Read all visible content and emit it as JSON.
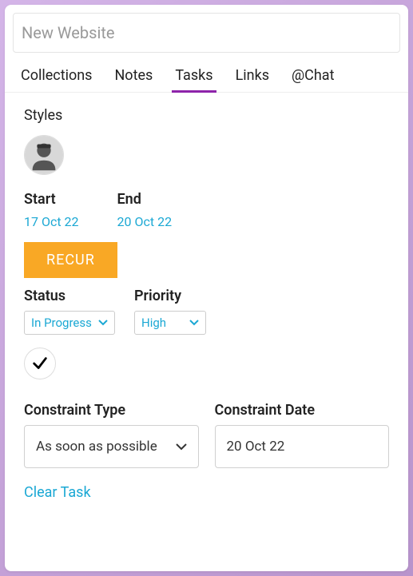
{
  "title_placeholder": "New Website",
  "tabs": {
    "collections": "Collections",
    "notes": "Notes",
    "tasks": "Tasks",
    "links": "Links",
    "chat": "@Chat"
  },
  "styles_label": "Styles",
  "dates": {
    "start_label": "Start",
    "start_value": "17 Oct 22",
    "end_label": "End",
    "end_value": "20 Oct 22"
  },
  "recur_button": "RECUR",
  "status": {
    "label": "Status",
    "value": "In Progress"
  },
  "priority": {
    "label": "Priority",
    "value": "High"
  },
  "constraint_type": {
    "label": "Constraint Type",
    "value": "As soon as possible"
  },
  "constraint_date": {
    "label": "Constraint Date",
    "value": "20 Oct 22"
  },
  "clear_task": "Clear Task"
}
